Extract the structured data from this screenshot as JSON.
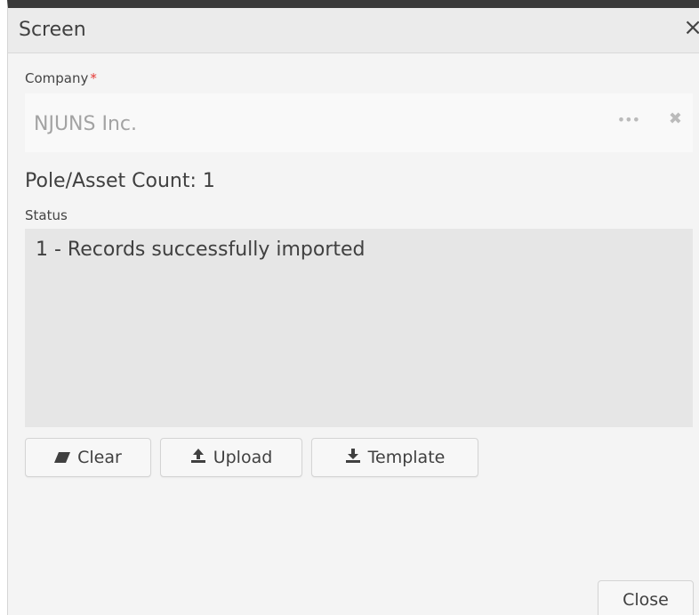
{
  "dialog": {
    "title": "Screen",
    "close_icon": "×"
  },
  "company": {
    "label": "Company",
    "required_mark": "*",
    "value": "NJUNS Inc.",
    "ellipsis_icon": "•••",
    "clear_icon": "✖"
  },
  "count": {
    "text": "Pole/Asset Count: 1"
  },
  "status": {
    "label": "Status",
    "value": "1 - Records successfully imported"
  },
  "actions": {
    "clear_label": "Clear",
    "upload_label": "Upload",
    "template_label": "Template"
  },
  "footer": {
    "close_label": "Close"
  }
}
